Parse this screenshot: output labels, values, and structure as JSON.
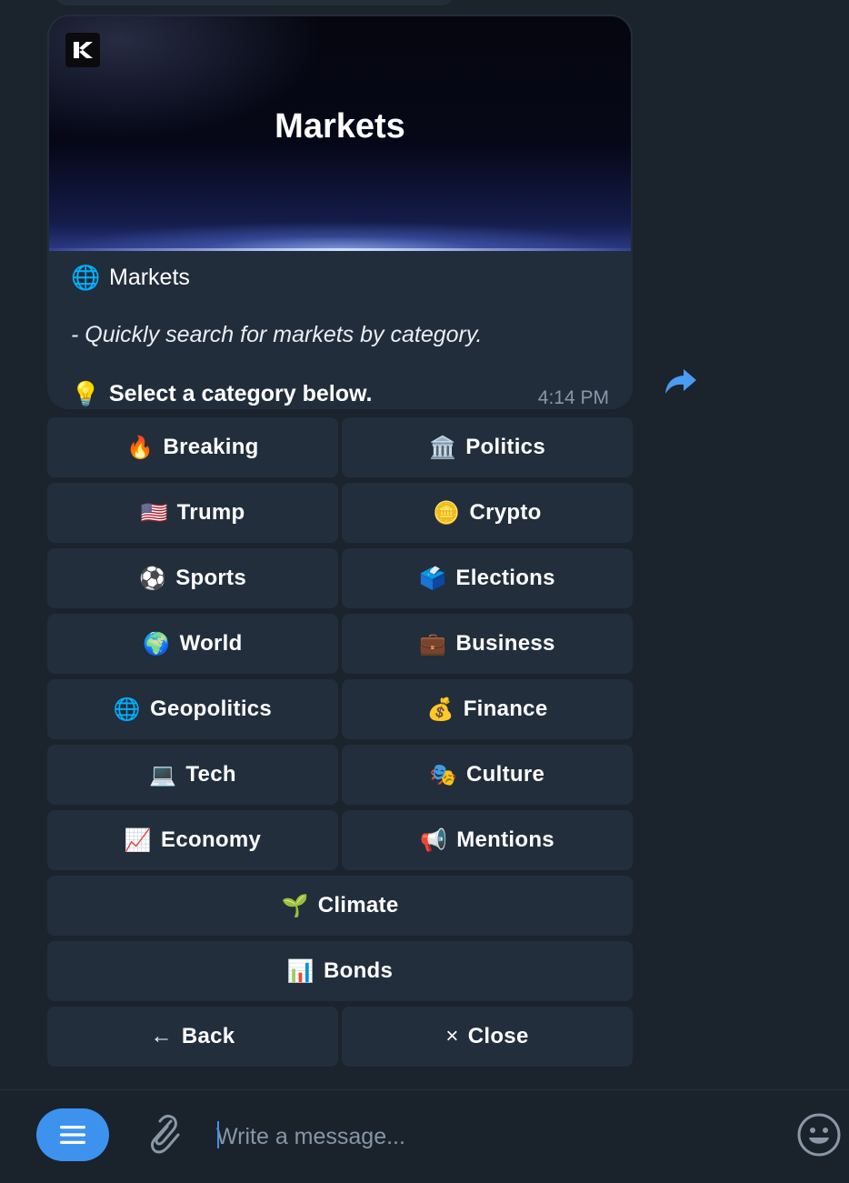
{
  "message": {
    "banner_title": "Markets",
    "line1": {
      "emoji": "🌐",
      "text": "Markets"
    },
    "line2": {
      "text": "- Quickly search for markets by category."
    },
    "line3": {
      "emoji": "💡",
      "text": "Select a category below."
    },
    "time": "4:14 PM"
  },
  "keyboard": {
    "breaking": {
      "emoji": "🔥",
      "label": "Breaking"
    },
    "politics": {
      "emoji": "🏛️",
      "label": "Politics"
    },
    "trump": {
      "emoji": "🇺🇸",
      "label": "Trump"
    },
    "crypto": {
      "emoji": "🪙",
      "label": "Crypto"
    },
    "sports": {
      "emoji": "⚽",
      "label": "Sports"
    },
    "elections": {
      "emoji": "🗳️",
      "label": "Elections"
    },
    "world": {
      "emoji": "🌍",
      "label": "World"
    },
    "business": {
      "emoji": "💼",
      "label": "Business"
    },
    "geopolitics": {
      "emoji": "🌐",
      "label": "Geopolitics"
    },
    "finance": {
      "emoji": "💰",
      "label": "Finance"
    },
    "tech": {
      "emoji": "💻",
      "label": "Tech"
    },
    "culture": {
      "emoji": "🎭",
      "label": "Culture"
    },
    "economy": {
      "emoji": "📈",
      "label": "Economy"
    },
    "mentions": {
      "emoji": "📢",
      "label": "Mentions"
    },
    "climate": {
      "emoji": "🌱",
      "label": "Climate"
    },
    "bonds": {
      "emoji": "📊",
      "label": "Bonds"
    },
    "back": {
      "emoji": "←",
      "label": "Back"
    },
    "close": {
      "emoji": "×",
      "label": "Close"
    }
  },
  "composer": {
    "placeholder": "Write a message..."
  },
  "colors": {
    "accent": "#3d92ee",
    "bubble": "#222d3b",
    "button": "#222e3c",
    "background": "#1b232d"
  },
  "icons": {
    "logo": "kalshi-logo-icon",
    "share": "share-arrow-icon",
    "menu": "menu-icon",
    "attach": "paperclip-icon",
    "emoji": "smiley-icon"
  }
}
